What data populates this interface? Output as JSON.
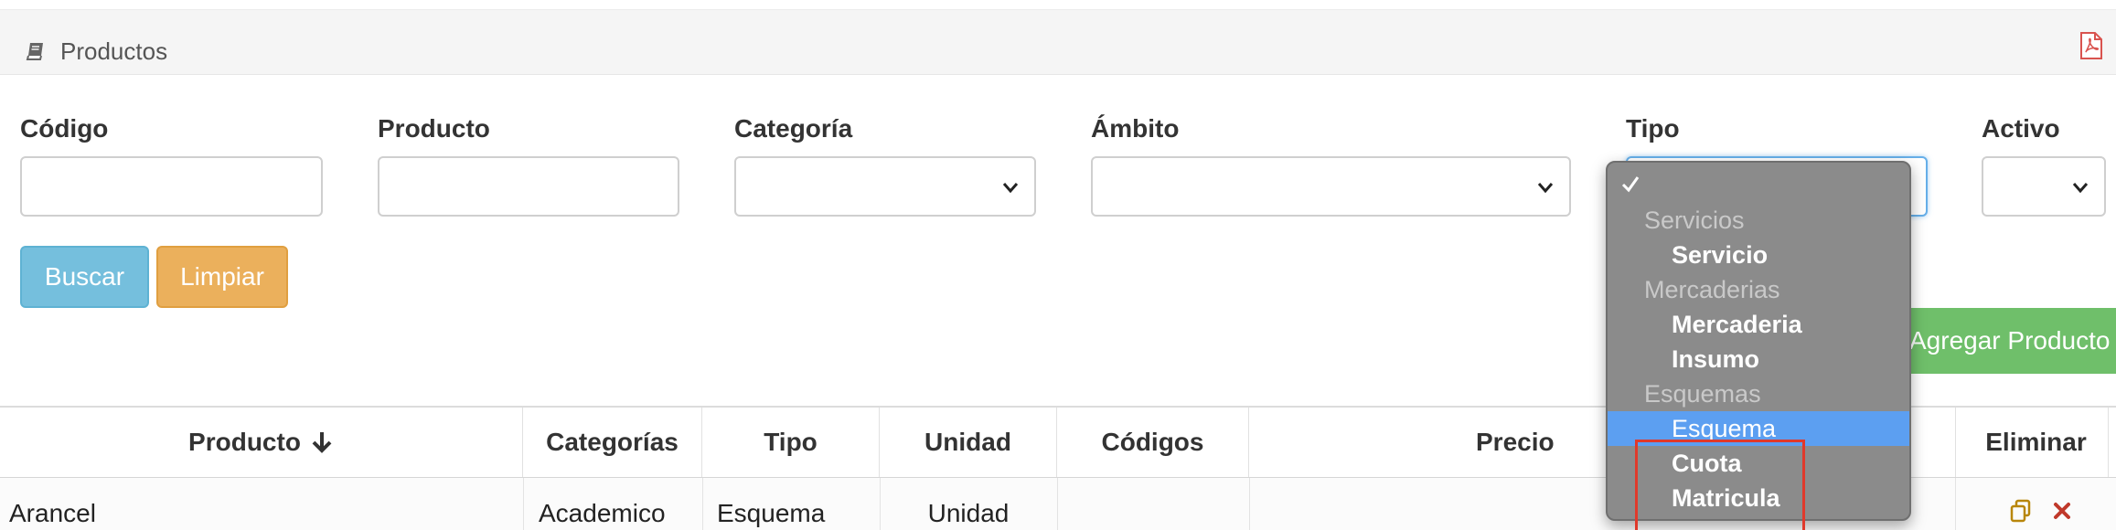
{
  "header": {
    "title": "Productos",
    "icons": [
      "book-icon",
      "pdf-icon"
    ]
  },
  "filters": {
    "codigo_label": "Código",
    "producto_label": "Producto",
    "categoria_label": "Categoría",
    "ambito_label": "Ámbito",
    "tipo_label": "Tipo",
    "activo_label": "Activo",
    "codigo_value": "",
    "producto_value": ""
  },
  "buttons": {
    "buscar": "Buscar",
    "limpiar": "Limpiar",
    "agregar": "Agregar Producto"
  },
  "table": {
    "columns": [
      "Producto",
      "Categorías",
      "Tipo",
      "Unidad",
      "Códigos",
      "Precio",
      "Eliminar"
    ],
    "sort_column": "Producto",
    "rows": [
      {
        "producto": "Arancel",
        "categorias": "Academico",
        "tipo": "Esquema",
        "unidad": "Unidad",
        "codigos": "",
        "precio": ""
      }
    ]
  },
  "tipo_dropdown": {
    "selected": "Esquema",
    "items": [
      {
        "kind": "option",
        "label": ""
      },
      {
        "kind": "group",
        "label": "Servicios"
      },
      {
        "kind": "option",
        "label": "Servicio"
      },
      {
        "kind": "group",
        "label": "Mercaderias"
      },
      {
        "kind": "option",
        "label": "Mercaderia"
      },
      {
        "kind": "option",
        "label": "Insumo"
      },
      {
        "kind": "group",
        "label": "Esquemas"
      },
      {
        "kind": "option",
        "label": "Esquema"
      },
      {
        "kind": "option",
        "label": "Cuota"
      },
      {
        "kind": "option",
        "label": "Matricula"
      }
    ]
  },
  "colors": {
    "buscar": "#75bfdd",
    "limpiar": "#ebb05c",
    "agregar": "#6fbf6a",
    "dropdown_bg": "#8b8b8b",
    "dropdown_selected": "#5c9ff1",
    "highlight_box": "#e0392b",
    "delete": "#c0392b"
  }
}
